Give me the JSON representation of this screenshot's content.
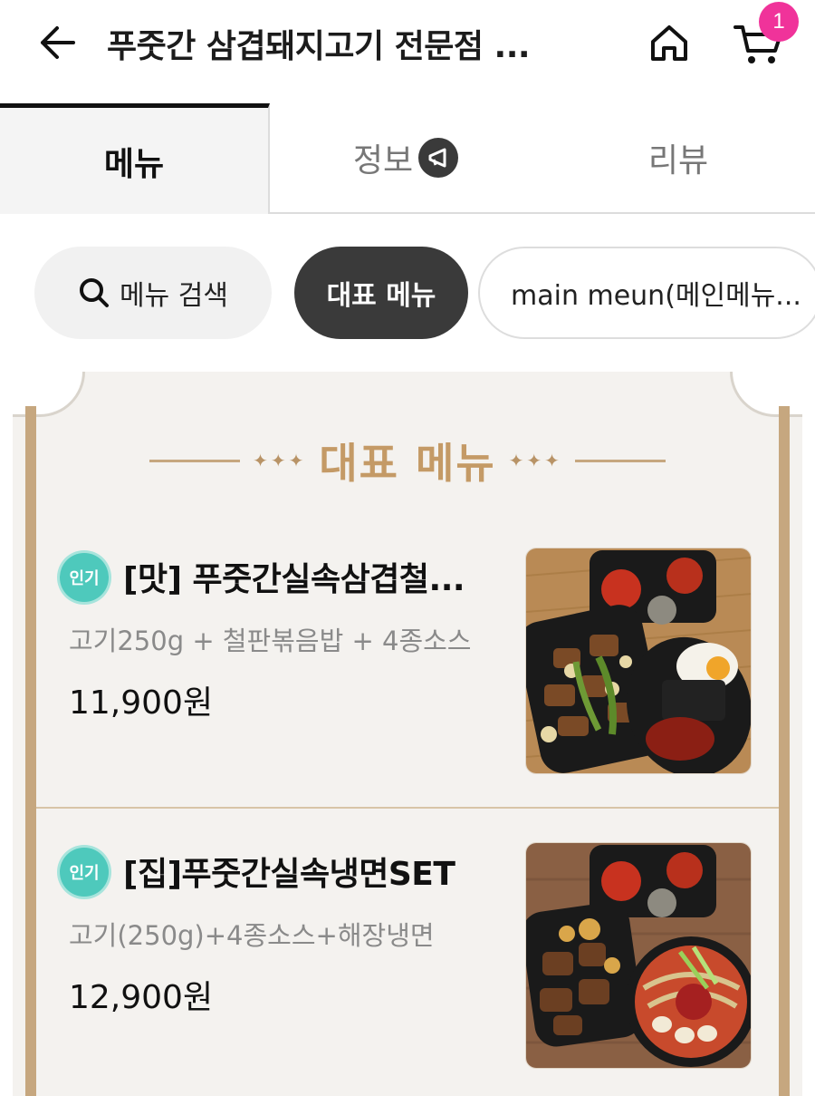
{
  "header": {
    "title": "푸줏간 삼겹돼지고기 전문점 ...",
    "cart_count": "1"
  },
  "tabs": [
    {
      "label": "메뉴",
      "active": true
    },
    {
      "label": "정보",
      "active": false
    },
    {
      "label": "리뷰",
      "active": false
    }
  ],
  "chips": {
    "search": "메뉴 검색",
    "main": "대표 메뉴",
    "sub": "main meun(메인메뉴..."
  },
  "section": {
    "title": "대표 메뉴"
  },
  "items": [
    {
      "badge": "인기",
      "name": "[맛] 푸줏간실속삼겹철...",
      "desc": "고기250g + 철판볶음밥 + 4종소스",
      "price": "11,900원"
    },
    {
      "badge": "인기",
      "name": "[집]푸줏간실속냉면SET",
      "desc": "고기(250g)+4종소스+해장냉면",
      "price": "12,900원"
    }
  ],
  "colors": {
    "accent_gold": "#c49a66",
    "badge_teal": "#4ec9bc",
    "cart_badge": "#f0339a",
    "chip_active": "#3a3a3a"
  }
}
